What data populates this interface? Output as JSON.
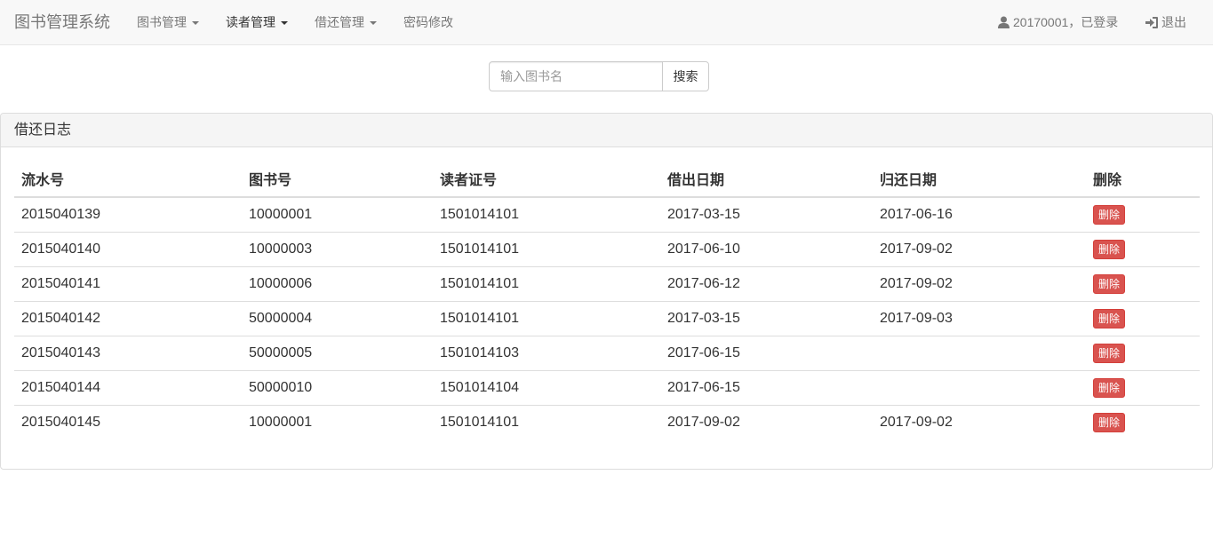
{
  "navbar": {
    "brand": "图书管理系统",
    "menus": [
      {
        "label": "图书管理",
        "dropdown": true,
        "active": false
      },
      {
        "label": "读者管理",
        "dropdown": true,
        "active": true
      },
      {
        "label": "借还管理",
        "dropdown": true,
        "active": false
      },
      {
        "label": "密码修改",
        "dropdown": false,
        "active": false
      }
    ],
    "user_status": "20170001，已登录",
    "logout_label": "退出",
    "icons": {
      "user": "user-icon",
      "logout": "logout-icon"
    }
  },
  "search": {
    "placeholder": "输入图书名",
    "value": "",
    "button_label": "搜索"
  },
  "panel": {
    "title": "借还日志",
    "columns": [
      "流水号",
      "图书号",
      "读者证号",
      "借出日期",
      "归还日期",
      "删除"
    ],
    "rows": [
      {
        "serial": "2015040139",
        "book_id": "10000001",
        "reader_id": "1501014101",
        "lend_date": "2017-03-15",
        "return_date": "2017-06-16",
        "action": "删除"
      },
      {
        "serial": "2015040140",
        "book_id": "10000003",
        "reader_id": "1501014101",
        "lend_date": "2017-06-10",
        "return_date": "2017-09-02",
        "action": "删除"
      },
      {
        "serial": "2015040141",
        "book_id": "10000006",
        "reader_id": "1501014101",
        "lend_date": "2017-06-12",
        "return_date": "2017-09-02",
        "action": "删除"
      },
      {
        "serial": "2015040142",
        "book_id": "50000004",
        "reader_id": "1501014101",
        "lend_date": "2017-03-15",
        "return_date": "2017-09-03",
        "action": "删除"
      },
      {
        "serial": "2015040143",
        "book_id": "50000005",
        "reader_id": "1501014103",
        "lend_date": "2017-06-15",
        "return_date": "",
        "action": "删除"
      },
      {
        "serial": "2015040144",
        "book_id": "50000010",
        "reader_id": "1501014104",
        "lend_date": "2017-06-15",
        "return_date": "",
        "action": "删除"
      },
      {
        "serial": "2015040145",
        "book_id": "10000001",
        "reader_id": "1501014101",
        "lend_date": "2017-09-02",
        "return_date": "2017-09-02",
        "action": "删除"
      }
    ]
  },
  "colors": {
    "navbar_bg": "#f8f8f8",
    "danger": "#d9534f",
    "panel_heading_bg": "#f5f5f5"
  }
}
